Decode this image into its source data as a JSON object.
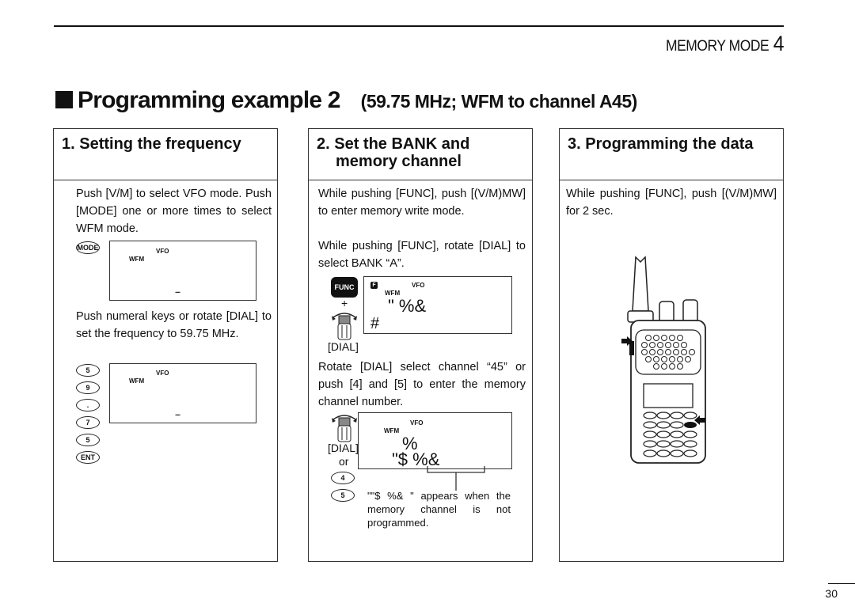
{
  "header": {
    "chapter_label": "MEMORY MODE",
    "chapter_number": "4"
  },
  "title": {
    "main": "Programming example 2",
    "sub": "(59.75 MHz; WFM to channel A45)"
  },
  "steps": [
    {
      "heading": "1. Setting the frequency",
      "paragraphs": [
        "Push [V/M] to select VFO mode. Push [MODE] one or more times to select WFM mode.",
        "Push numeral keys or rotate [DIAL] to set the frequency to 59.75 MHz."
      ],
      "mode_key": "MODE",
      "lcd1": {
        "vfo": "VFO",
        "mode": "WFM",
        "dash": "....."
      },
      "keys": [
        "5",
        "9",
        ".",
        "7",
        "5",
        "ENT"
      ],
      "lcd2": {
        "vfo": "VFO",
        "mode": "WFM",
        "dash": "....."
      }
    },
    {
      "heading_line1": "2. Set the BANK and",
      "heading_line2": "memory channel",
      "paragraphs": [
        "While pushing [FUNC], push [(V/M)MW] to enter memory write mode.",
        "While pushing [FUNC], rotate [DIAL] to select BANK “A”.",
        "Rotate [DIAL] select channel “45” or push [4] and [5] to enter the memory channel number."
      ],
      "func_key": "FUNC",
      "plus": "+",
      "dial_label": "[DIAL]",
      "lcd1": {
        "f_icon": "F",
        "vfo": "VFO",
        "mode": "WFM",
        "seg_line1": "\" %&",
        "seg_line2": "#"
      },
      "dial_label2": "[DIAL]",
      "or_label": "or",
      "keys": [
        "4",
        "5"
      ],
      "lcd2": {
        "vfo": "VFO",
        "mode": "WFM",
        "seg_line1": "%",
        "seg_line2": "\"$ %&"
      },
      "note": "\"\"$ %&  \" appears when the memory channel is not programmed."
    },
    {
      "heading": "3. Programming the data",
      "paragraphs": [
        "While pushing [FUNC], push [(V/M)MW] for 2 sec."
      ]
    }
  ],
  "page_number": "30"
}
